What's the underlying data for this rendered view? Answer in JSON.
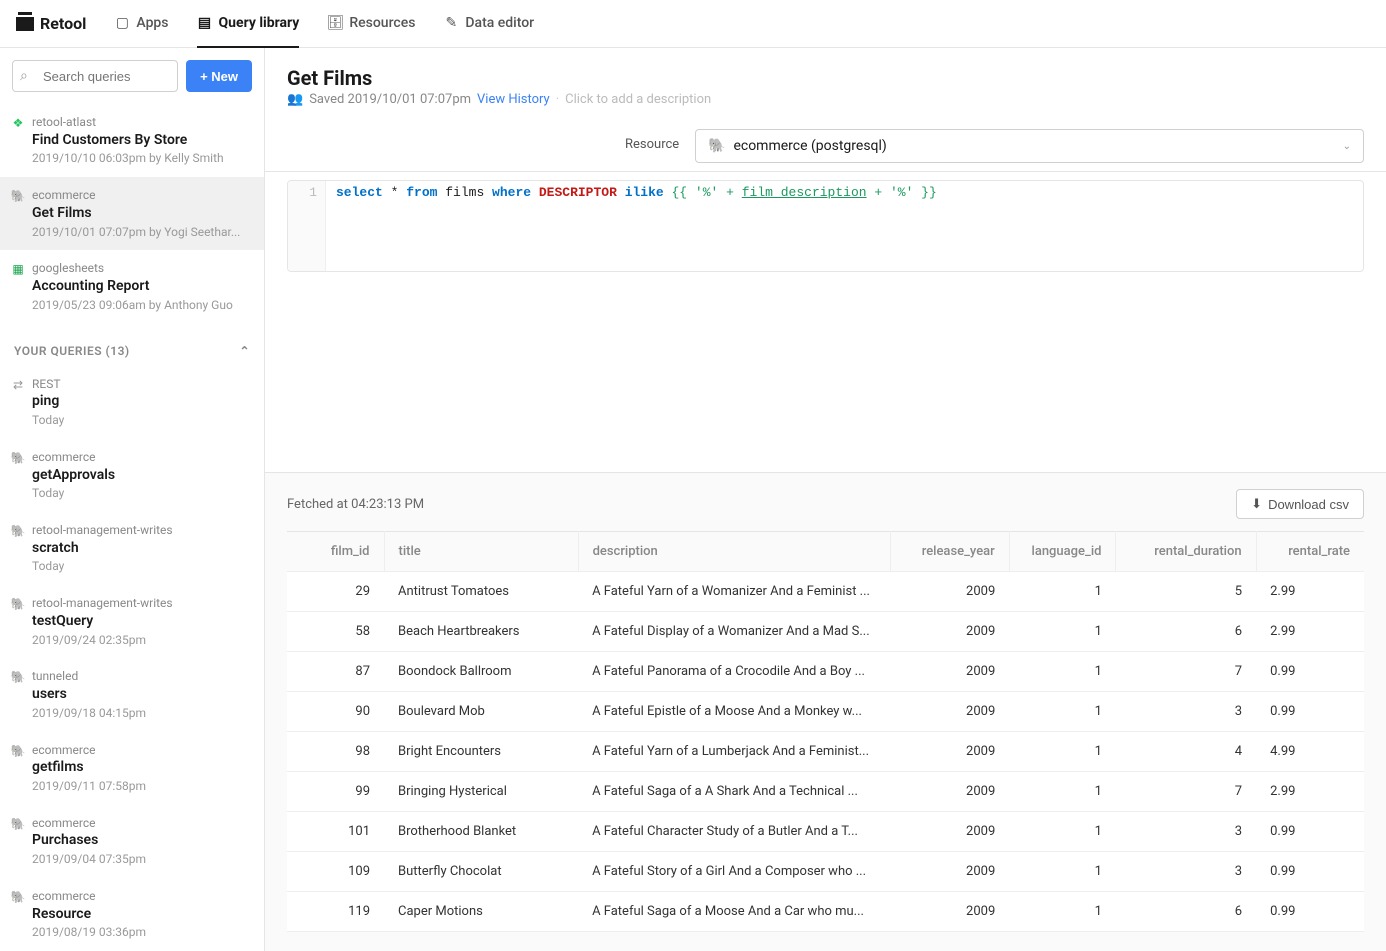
{
  "brand": "Retool",
  "nav": {
    "apps": "Apps",
    "query_library": "Query library",
    "resources": "Resources",
    "data_editor": "Data editor"
  },
  "sidebar": {
    "search_placeholder": "Search queries",
    "new_label": "+ New",
    "recent": [
      {
        "resource": "retool-atlast",
        "title": "Find Customers By Store",
        "meta": "2019/10/10 06:03pm by Kelly Smith",
        "icon": "leaf"
      },
      {
        "resource": "ecommerce",
        "title": "Get Films",
        "meta": "2019/10/01 07:07pm by Yogi Seethar...",
        "icon": "db"
      },
      {
        "resource": "googlesheets",
        "title": "Accounting Report",
        "meta": "2019/05/23 09:06am by Anthony Guo",
        "icon": "sheet"
      }
    ],
    "section_label": "YOUR QUERIES (13)",
    "your_queries": [
      {
        "resource": "REST",
        "title": "ping",
        "meta": "Today",
        "icon": "rest"
      },
      {
        "resource": "ecommerce",
        "title": "getApprovals",
        "meta": "Today",
        "icon": "db"
      },
      {
        "resource": "retool-management-writes",
        "title": "scratch",
        "meta": "Today",
        "icon": "db"
      },
      {
        "resource": "retool-management-writes",
        "title": "testQuery",
        "meta": "2019/09/24 02:35pm",
        "icon": "db"
      },
      {
        "resource": "tunneled",
        "title": "users",
        "meta": "2019/09/18 04:15pm",
        "icon": "db"
      },
      {
        "resource": "ecommerce",
        "title": "getfilms",
        "meta": "2019/09/11 07:58pm",
        "icon": "db"
      },
      {
        "resource": "ecommerce",
        "title": "Purchases",
        "meta": "2019/09/04 07:35pm",
        "icon": "db"
      },
      {
        "resource": "ecommerce",
        "title": "Resource",
        "meta": "2019/08/19 03:36pm",
        "icon": "db"
      }
    ]
  },
  "header": {
    "title": "Get Films",
    "saved_prefix": "Saved 2019/10/01 07:07pm",
    "view_history": "View History",
    "desc_placeholder": "Click to add a description"
  },
  "resource_row": {
    "label": "Resource",
    "selected": "ecommerce (postgresql)"
  },
  "editor": {
    "line_no": "1",
    "sql": {
      "select": "select",
      "star_from": " * ",
      "from": "from",
      "table": " films ",
      "where": "where",
      "descriptor": " DESCRIPTOR ",
      "ilike": "ilike",
      "tpl_open": " {{ ",
      "q1": "'%'",
      "plus1": " + ",
      "var": "film_description",
      "plus2": " + ",
      "q2": "'%'",
      "tpl_close": " }}"
    }
  },
  "results": {
    "fetched_label": "Fetched at 04:23:13 PM",
    "download_label": "Download csv",
    "columns": [
      "film_id",
      "title",
      "description",
      "release_year",
      "language_id",
      "rental_duration",
      "rental_rate"
    ],
    "rows": [
      {
        "film_id": 29,
        "title": "Antitrust Tomatoes",
        "description": "A Fateful Yarn of a Womanizer And a Feminist ...",
        "release_year": 2009,
        "language_id": 1,
        "rental_duration": 5,
        "rental_rate": "2.99"
      },
      {
        "film_id": 58,
        "title": "Beach Heartbreakers",
        "description": "A Fateful Display of a Womanizer And a Mad S...",
        "release_year": 2009,
        "language_id": 1,
        "rental_duration": 6,
        "rental_rate": "2.99"
      },
      {
        "film_id": 87,
        "title": "Boondock Ballroom",
        "description": "A Fateful Panorama of a Crocodile And a Boy ...",
        "release_year": 2009,
        "language_id": 1,
        "rental_duration": 7,
        "rental_rate": "0.99"
      },
      {
        "film_id": 90,
        "title": "Boulevard Mob",
        "description": "A Fateful Epistle of a Moose And a Monkey w...",
        "release_year": 2009,
        "language_id": 1,
        "rental_duration": 3,
        "rental_rate": "0.99"
      },
      {
        "film_id": 98,
        "title": "Bright Encounters",
        "description": "A Fateful Yarn of a Lumberjack And a Feminist...",
        "release_year": 2009,
        "language_id": 1,
        "rental_duration": 4,
        "rental_rate": "4.99"
      },
      {
        "film_id": 99,
        "title": "Bringing Hysterical",
        "description": "A Fateful Saga of a A Shark And a Technical ...",
        "release_year": 2009,
        "language_id": 1,
        "rental_duration": 7,
        "rental_rate": "2.99"
      },
      {
        "film_id": 101,
        "title": "Brotherhood Blanket",
        "description": "A Fateful Character Study of a Butler And a T...",
        "release_year": 2009,
        "language_id": 1,
        "rental_duration": 3,
        "rental_rate": "0.99"
      },
      {
        "film_id": 109,
        "title": "Butterfly Chocolat",
        "description": "A Fateful Story of a Girl And a Composer who ...",
        "release_year": 2009,
        "language_id": 1,
        "rental_duration": 3,
        "rental_rate": "0.99"
      },
      {
        "film_id": 119,
        "title": "Caper Motions",
        "description": "A Fateful Saga of a Moose And a Car who mu...",
        "release_year": 2009,
        "language_id": 1,
        "rental_duration": 6,
        "rental_rate": "0.99"
      }
    ]
  }
}
